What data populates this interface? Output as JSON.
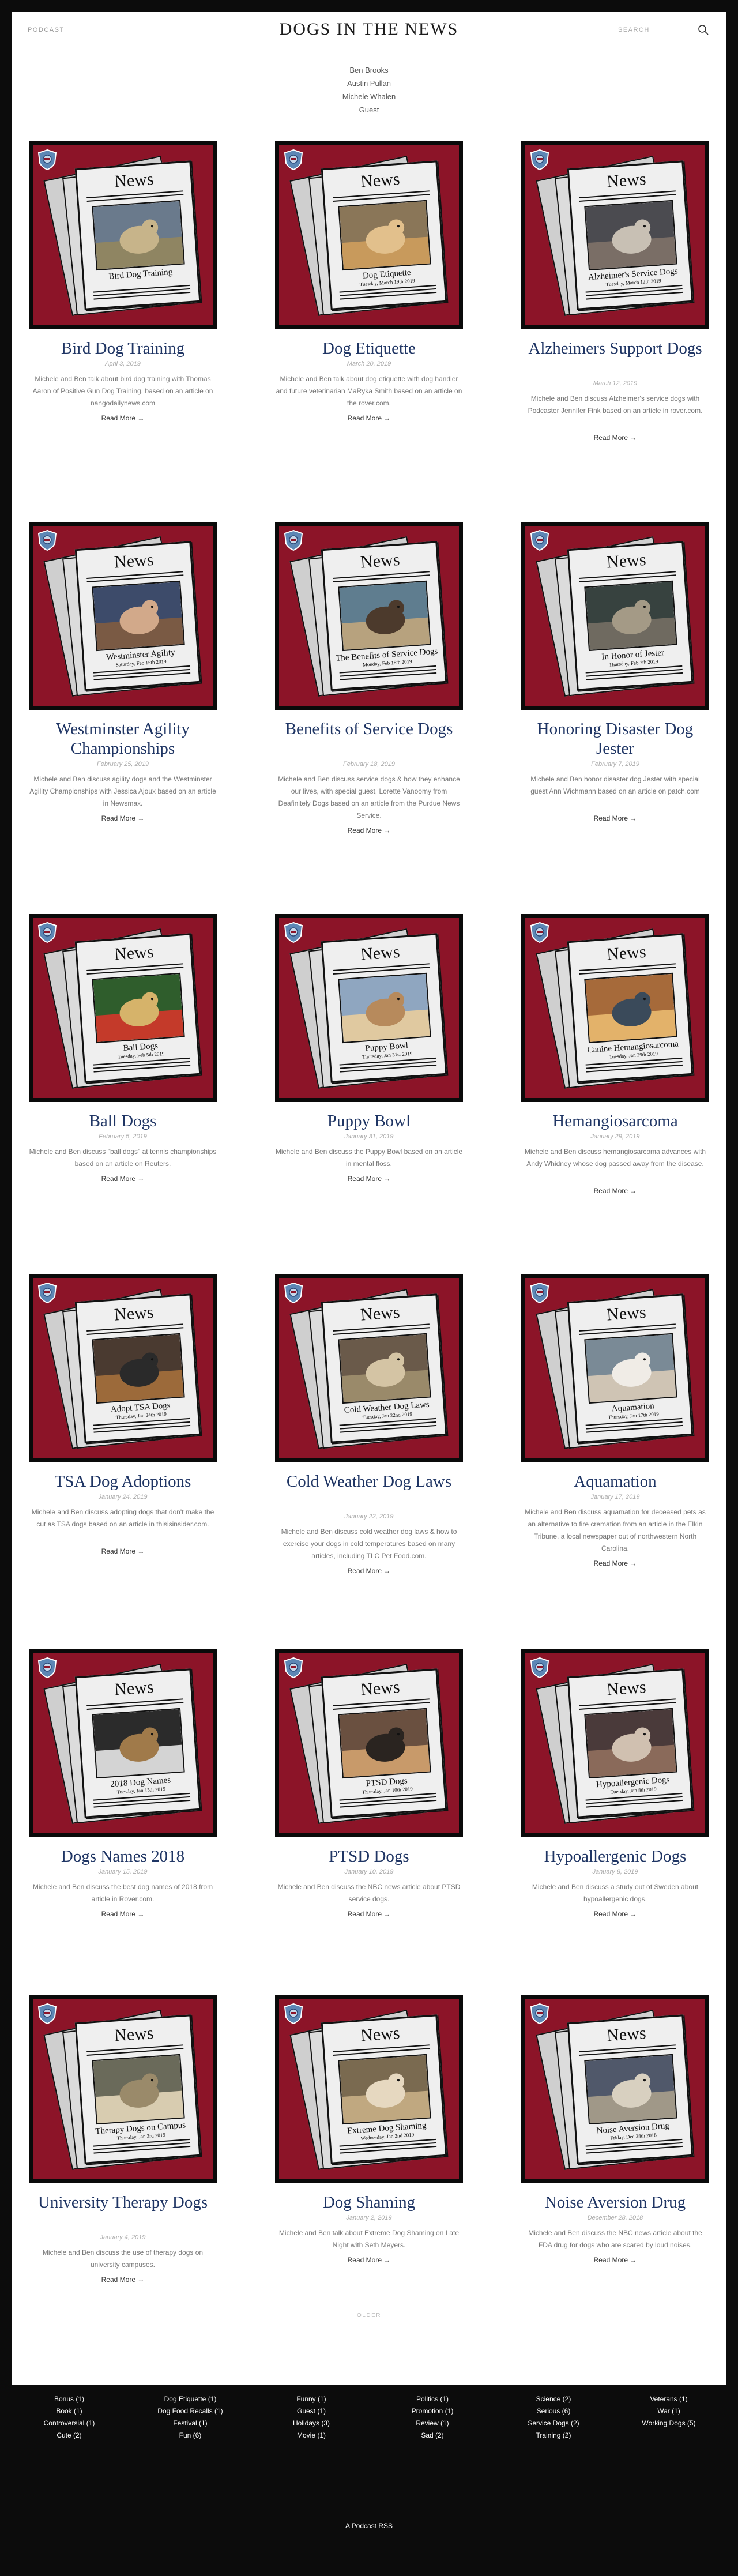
{
  "header": {
    "podcast_link": "PODCAST",
    "site_title": "DOGS IN THE NEWS",
    "search_placeholder": "SEARCH"
  },
  "people": [
    "Ben Brooks",
    "Austin Pullan",
    "Michele Whalen",
    "Guest"
  ],
  "posts": [
    {
      "title": "Bird Dog Training",
      "date": "April 3, 2019",
      "excerpt": "Michele and Ben talk about bird dog training with Thomas Aaron of Positive Gun Dog Training, based on an article on nangodailynews.com",
      "read_more": "Read More",
      "news_word": "News",
      "caption": "Bird Dog Training",
      "news_date": ""
    },
    {
      "title": "Dog Etiquette",
      "date": "March 20, 2019",
      "excerpt": "Michele and Ben talk about dog etiquette with dog handler and future veterinarian MaRyka Smith based on an article on the rover.com.",
      "read_more": "Read More",
      "news_word": "News",
      "caption": "Dog Etiquette",
      "news_date": "Tuesday, March 19th 2019"
    },
    {
      "title": "Alzheimers Support Dogs",
      "date": "March 12, 2019",
      "excerpt": "Michele and Ben discuss Alzheimer's service dogs with Podcaster Jennifer Fink based on an article in rover.com.",
      "read_more": "Read More",
      "news_word": "News",
      "caption": "Alzheimer's Service Dogs",
      "news_date": "Tuesday, March 12th 2019"
    },
    {
      "title": "Westminster Agility Championships",
      "date": "February 25, 2019",
      "excerpt": "Michele and Ben discuss agility dogs and the Westminster Agility Championships with Jessica Ajoux based on an article in Newsmax.",
      "read_more": "Read More",
      "news_word": "News",
      "caption": "Westminster Agility",
      "news_date": "Saturday, Feb 15th 2019"
    },
    {
      "title": "Benefits of Service Dogs",
      "date": "February 18, 2019",
      "excerpt": "Michele and Ben discuss service dogs & how they enhance our lives, with special guest, Lorette Vanoomy from Deafinitely Dogs based on an article from the Purdue News Service.",
      "read_more": "Read More",
      "news_word": "News",
      "caption": "The Benefits of Service Dogs",
      "news_date": "Monday, Feb 18th 2019"
    },
    {
      "title": "Honoring Disaster Dog Jester",
      "date": "February 7, 2019",
      "excerpt": "Michele and Ben honor disaster dog Jester with special guest Ann Wichmann based on an article on patch.com",
      "read_more": "Read More",
      "news_word": "News",
      "caption": "In Honor of Jester",
      "news_date": "Thursday, Feb 7th 2019"
    },
    {
      "title": "Ball Dogs",
      "date": "February 5, 2019",
      "excerpt": "Michele and Ben discuss \"ball dogs\" at tennis championships based on an article on Reuters.",
      "read_more": "Read More",
      "news_word": "News",
      "caption": "Ball Dogs",
      "news_date": "Tuesday, Feb 5th 2019"
    },
    {
      "title": "Puppy Bowl",
      "date": "January 31, 2019",
      "excerpt": "Michele and Ben discuss the Puppy Bowl based on an article in mental floss.",
      "read_more": "Read More",
      "news_word": "News",
      "caption": "Puppy Bowl",
      "news_date": "Thursday, Jan 31st 2019"
    },
    {
      "title": "Hemangiosarcoma",
      "date": "January 29, 2019",
      "excerpt": "Michele and Ben discuss hemangiosarcoma advances with Andy Whidney whose dog passed away from the disease.",
      "read_more": "Read More",
      "news_word": "News",
      "caption": "Canine Hemangiosarcoma",
      "news_date": "Tuesday, Jan 29th 2019"
    },
    {
      "title": "TSA Dog Adoptions",
      "date": "January 24, 2019",
      "excerpt": "Michele and Ben discuss adopting dogs that don't make the cut as TSA dogs based on an article in thisisinsider.com.",
      "read_more": "Read More",
      "news_word": "News",
      "caption": "Adopt TSA Dogs",
      "news_date": "Thursday, Jan 24th 2019"
    },
    {
      "title": "Cold Weather Dog Laws",
      "date": "January 22, 2019",
      "excerpt": "Michele and Ben discuss cold weather dog laws & how to exercise your dogs in cold temperatures based on many articles, including TLC Pet Food.com.",
      "read_more": "Read More",
      "news_word": "News",
      "caption": "Cold Weather Dog Laws",
      "news_date": "Tuesday, Jan 22nd 2019"
    },
    {
      "title": "Aquamation",
      "date": "January 17, 2019",
      "excerpt": "Michele and Ben discuss aquamation for deceased pets as an alternative to fire cremation from an article in the Elkin Tribune, a local newspaper out of northwestern North Carolina.",
      "read_more": "Read More",
      "news_word": "News",
      "caption": "Aquamation",
      "news_date": "Thursday, Jan 17th 2019"
    },
    {
      "title": "Dogs Names 2018",
      "date": "January 15, 2019",
      "excerpt": "Michele and Ben discuss the best dog names of 2018 from article in Rover.com.",
      "read_more": "Read More",
      "news_word": "News",
      "caption": "2018 Dog Names",
      "news_date": "Tuesday, Jan 15th 2019"
    },
    {
      "title": "PTSD Dogs",
      "date": "January 10, 2019",
      "excerpt": "Michele and Ben discuss the NBC news article about PTSD service dogs.",
      "read_more": "Read More",
      "news_word": "News",
      "caption": "PTSD Dogs",
      "news_date": "Thursday, Jan 10th 2019"
    },
    {
      "title": "Hypoallergenic Dogs",
      "date": "January 8, 2019",
      "excerpt": "Michele and Ben discuss a study out of Sweden about hypoallergenic dogs.",
      "read_more": "Read More",
      "news_word": "News",
      "caption": "Hypoallergenic Dogs",
      "news_date": "Tuesday, Jan 8th 2019"
    },
    {
      "title": "University Therapy Dogs",
      "date": "January 4, 2019",
      "excerpt": "Michele and Ben discuss the use of therapy dogs on university campuses.",
      "read_more": "Read More",
      "news_word": "News",
      "caption": "Therapy Dogs on Campus",
      "news_date": "Thursday, Jan 3rd 2019"
    },
    {
      "title": "Dog Shaming",
      "date": "January 2, 2019",
      "excerpt": "Michele and Ben talk about Extreme Dog Shaming on Late Night with Seth Meyers.",
      "read_more": "Read More",
      "news_word": "News",
      "caption": "Extreme Dog Shaming",
      "news_date": "Wednesday, Jan 2nd 2019"
    },
    {
      "title": "Noise Aversion Drug",
      "date": "December 28, 2018",
      "excerpt": "Michele and Ben discuss the NBC news article about the FDA drug for dogs who are scared by loud noises.",
      "read_more": "Read More",
      "news_word": "News",
      "caption": "Noise Aversion Drug",
      "news_date": "Friday, Dec 28th 2018"
    }
  ],
  "pagination": {
    "older": "OLDER"
  },
  "footer": {
    "columns": [
      [
        "Bonus (1)",
        "Book (1)",
        "Controversial (1)",
        "Cute (2)"
      ],
      [
        "Dog Etiquette (1)",
        "Dog Food Recalls (1)",
        "Festival (1)",
        "Fun (6)"
      ],
      [
        "Funny (1)",
        "Guest (1)",
        "Holidays (3)",
        "Movie (1)"
      ],
      [
        "Politics (1)",
        "Promotion (1)",
        "Review (1)",
        "Sad (2)"
      ],
      [
        "Science (2)",
        "Serious (6)",
        "Service Dogs (2)",
        "Training (2)"
      ],
      [
        "Veterans (1)",
        "War (1)",
        "Working Dogs (5)"
      ]
    ],
    "rss": "A Podcast RSS"
  },
  "colors": {
    "title_blue": "#1f3564",
    "thumb_red": "#8c1428",
    "footer_bg": "#0c0c0c"
  }
}
